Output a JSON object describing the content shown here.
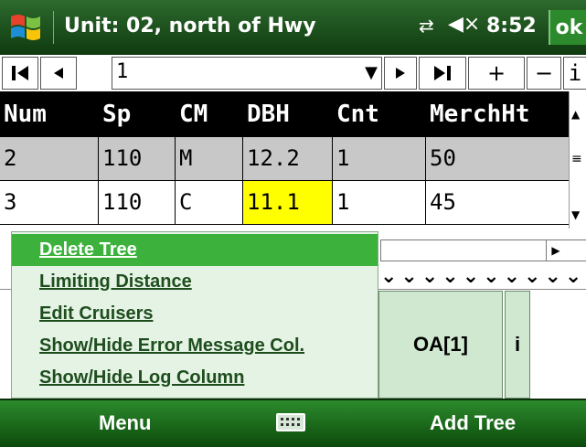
{
  "titlebar": {
    "title": "Unit: 02, north of Hwy",
    "clock": "8:52",
    "ok_label": "ok"
  },
  "navbar": {
    "first_label": "⏮",
    "prev_label": "◀",
    "record_value": "1",
    "next_label": "▶",
    "last_label": "⏭",
    "add_label": "+",
    "remove_label": "−",
    "info_label": "i"
  },
  "grid": {
    "columns": [
      "Num",
      "Sp",
      "CM",
      "DBH",
      "Cnt",
      "MerchHt"
    ],
    "rows": [
      [
        "2",
        "110",
        "M",
        "12.2",
        "1",
        "50"
      ],
      [
        "3",
        "110",
        "C",
        "11.1",
        "1",
        "45"
      ]
    ]
  },
  "context_menu": {
    "items": [
      {
        "label": "Delete Tree",
        "selected": true
      },
      {
        "label": "Limiting Distance",
        "selected": false
      },
      {
        "label": "Edit Cruisers",
        "selected": false
      },
      {
        "label": "Show/Hide Error Message Col.",
        "selected": false
      },
      {
        "label": "Show/Hide Log Column",
        "selected": false
      }
    ]
  },
  "action_buttons": {
    "oa_label": "OA[1]",
    "info_label": "i"
  },
  "chevrons": "⌄⌄⌄⌄⌄⌄⌄⌄⌄⌄",
  "softkeys": {
    "left_label": "Menu",
    "right_label": "Add Tree"
  },
  "colors": {
    "title_bar": "#1b4d1b",
    "menu_selected": "#3cb23c",
    "menu_background": "#e4f3e4",
    "highlight_cell": "#ffff00",
    "action_button": "#cfe8cf"
  },
  "icons": {
    "start": "windows-logo-icon",
    "connection": "connectivity-icon",
    "volume": "volume-muted-icon",
    "keyboard": "keyboard-icon"
  }
}
